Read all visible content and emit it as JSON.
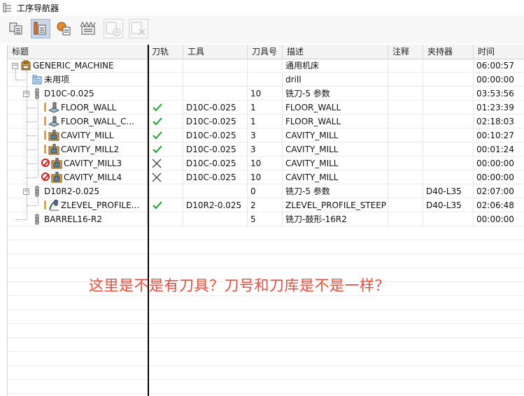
{
  "window": {
    "title": "工序导航器"
  },
  "toolbar": {
    "buttons": [
      {
        "name": "program-order-view-button",
        "icon": "program-order-view-icon",
        "active": false
      },
      {
        "name": "machine-tool-view-button",
        "icon": "machine-tool-view-icon",
        "active": true
      },
      {
        "name": "geometry-view-button",
        "icon": "geometry-view-icon",
        "active": false
      },
      {
        "name": "machining-method-view-button",
        "icon": "machining-method-view-icon",
        "active": false
      },
      {
        "name": "insert-operation-button",
        "icon": "insert-icon",
        "disabled": true
      },
      {
        "name": "delete-operation-button",
        "icon": "delete-icon",
        "disabled": true
      }
    ]
  },
  "columns": {
    "name": "标题",
    "toolpath": "刀轨",
    "tool": "工具",
    "tool_number": "刀具号",
    "description": "描述",
    "comment": "注释",
    "holder": "夹持器",
    "time": "时间"
  },
  "rows": [
    {
      "name": "GENERIC_MACHINE",
      "toolpath": "",
      "tool": "",
      "tool_number": "",
      "description": "通用机床",
      "comment": "",
      "holder": "",
      "time": "06:00:57"
    },
    {
      "name": "未用项",
      "toolpath": "",
      "tool": "",
      "tool_number": "",
      "description": "drill",
      "comment": "",
      "holder": "",
      "time": "00:00:00"
    },
    {
      "name": "D10C-0.025",
      "toolpath": "",
      "tool": "",
      "tool_number": "10",
      "description": "铣刀-5 参数",
      "comment": "",
      "holder": "",
      "time": "03:53:56"
    },
    {
      "name": "FLOOR_WALL",
      "toolpath": "ok",
      "tool": "D10C-0.025",
      "tool_number": "1",
      "description": "FLOOR_WALL",
      "comment": "",
      "holder": "",
      "time": "01:23:39"
    },
    {
      "name": "FLOOR_WALL_C...",
      "toolpath": "ok",
      "tool": "D10C-0.025",
      "tool_number": "1",
      "description": "FLOOR_WALL",
      "comment": "",
      "holder": "",
      "time": "02:18:03"
    },
    {
      "name": "CAVITY_MILL",
      "toolpath": "ok",
      "tool": "D10C-0.025",
      "tool_number": "3",
      "description": "CAVITY_MILL",
      "comment": "",
      "holder": "",
      "time": "00:10:27"
    },
    {
      "name": "CAVITY_MILL2",
      "toolpath": "ok",
      "tool": "D10C-0.025",
      "tool_number": "3",
      "description": "CAVITY_MILL",
      "comment": "",
      "holder": "",
      "time": "00:01:24"
    },
    {
      "name": "CAVITY_MILL3",
      "toolpath": "none",
      "tool": "D10C-0.025",
      "tool_number": "10",
      "description": "CAVITY_MILL",
      "comment": "",
      "holder": "",
      "time": "00:00:00"
    },
    {
      "name": "CAVITY_MILL4",
      "toolpath": "none",
      "tool": "D10C-0.025",
      "tool_number": "10",
      "description": "CAVITY_MILL",
      "comment": "",
      "holder": "",
      "time": "00:00:00"
    },
    {
      "name": "D10R2-0.025",
      "toolpath": "",
      "tool": "",
      "tool_number": "0",
      "description": "铣刀-5 参数",
      "comment": "",
      "holder": "D40-L35",
      "time": "02:07:00"
    },
    {
      "name": "ZLEVEL_PROFILE...",
      "toolpath": "ok",
      "tool": "D10R2-0.025",
      "tool_number": "2",
      "description": "ZLEVEL_PROFILE_STEEP",
      "comment": "",
      "holder": "D40-L35",
      "time": "02:06:48"
    },
    {
      "name": "BARREL16-R2",
      "toolpath": "",
      "tool": "",
      "tool_number": "5",
      "description": "铣刀-鼓形-16R2",
      "comment": "",
      "holder": "",
      "time": "00:00:00"
    }
  ],
  "annotation": "这里是不是有刀具？刀号和刀库是不是一样？",
  "colors": {
    "check": "#1aa52a",
    "warning": "#f0a020",
    "stop": "#d81a1a",
    "annotation": "#e94b3c",
    "active_button": "#c9d7ea"
  }
}
